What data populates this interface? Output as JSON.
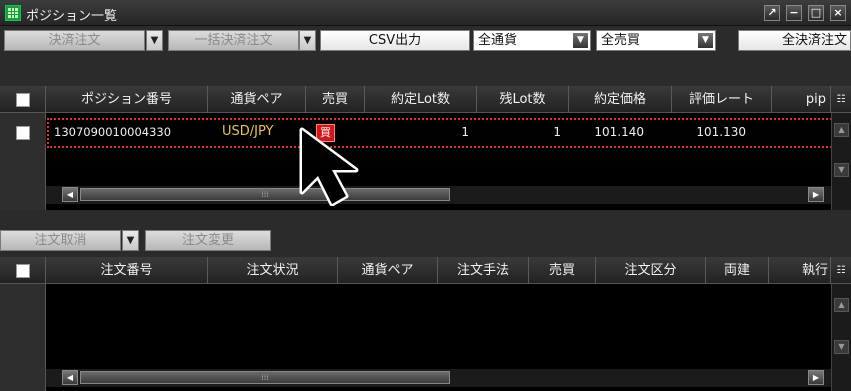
{
  "window": {
    "title": "ポジション一覧",
    "buttons": [
      "↗",
      "−",
      "□",
      "×"
    ]
  },
  "position_toolbar": {
    "settle_label": "決済注文",
    "bulk_settle_label": "一括決済注文",
    "csv_label": "CSV出力",
    "currency_filter": "全通貨",
    "side_filter": "全売買",
    "all_settle_label": "全決済注文"
  },
  "position_grid": {
    "headers": [
      "ポジション番号",
      "通貨ペア",
      "売買",
      "約定Lot数",
      "残Lot数",
      "約定価格",
      "評価レート",
      "pip"
    ],
    "rows": [
      {
        "position_no": "1307090010004330",
        "pair": "USD/JPY",
        "side": "買",
        "exec_lot": "1",
        "remain_lot": "1",
        "exec_price": "101.140",
        "eval_rate": "101.130",
        "pip": ""
      }
    ]
  },
  "order_toolbar": {
    "cancel_label": "注文取消",
    "modify_label": "注文変更"
  },
  "order_grid": {
    "headers": [
      "注文番号",
      "注文状況",
      "通貨ペア",
      "注文手法",
      "売買",
      "注文区分",
      "両建",
      "執行"
    ]
  },
  "colors": {
    "accent_pair": "#e8c64a",
    "buy_badge": "#d01818",
    "selection_outline": "#e03030"
  },
  "icons": {
    "app": "grid-icon",
    "cursor": "arrow-pointer-icon",
    "dropdown": "triangle-down-icon"
  }
}
